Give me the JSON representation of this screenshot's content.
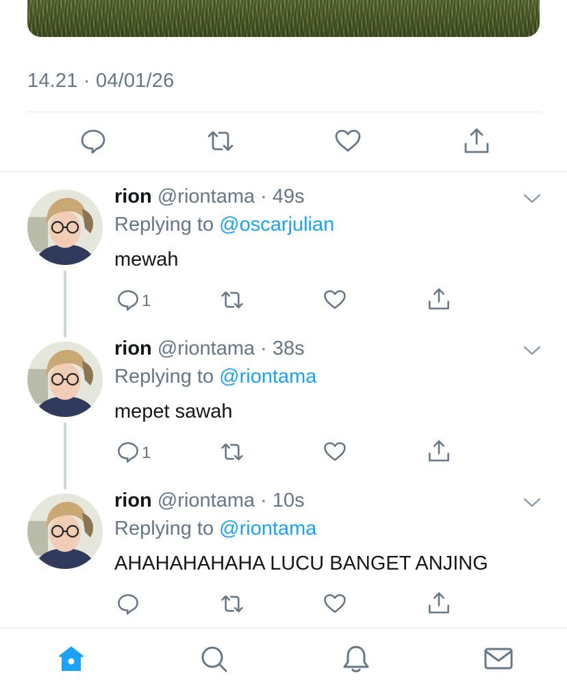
{
  "tweet": {
    "timestamp": "14.21 · 04/01/26",
    "actions": {
      "reply_icon": "reply-icon",
      "retweet_icon": "retweet-icon",
      "like_icon": "heart-icon",
      "share_icon": "share-icon"
    }
  },
  "replies": [
    {
      "name": "rion",
      "handle": "@riontama",
      "time": "49s",
      "replying_prefix": "Replying to ",
      "replying_to": "@oscarjulian",
      "text": "mewah",
      "reply_count": "1"
    },
    {
      "name": "rion",
      "handle": "@riontama",
      "time": "38s",
      "replying_prefix": "Replying to ",
      "replying_to": "@riontama",
      "text": "mepet sawah",
      "reply_count": "1"
    },
    {
      "name": "rion",
      "handle": "@riontama",
      "time": "10s",
      "replying_prefix": "Replying to ",
      "replying_to": "@riontama",
      "text": "AHAHAHAHAHA LUCU BANGET ANJING",
      "reply_count": ""
    }
  ],
  "tabbar": {
    "home_icon": "home-icon",
    "search_icon": "search-icon",
    "notifications_icon": "bell-icon",
    "messages_icon": "mail-icon",
    "active": "home"
  },
  "colors": {
    "accent": "#1da1f2",
    "icon_gray": "#657786",
    "text": "#14171a",
    "divider": "#e1e8ed",
    "thread_line": "#ccd6dd"
  }
}
